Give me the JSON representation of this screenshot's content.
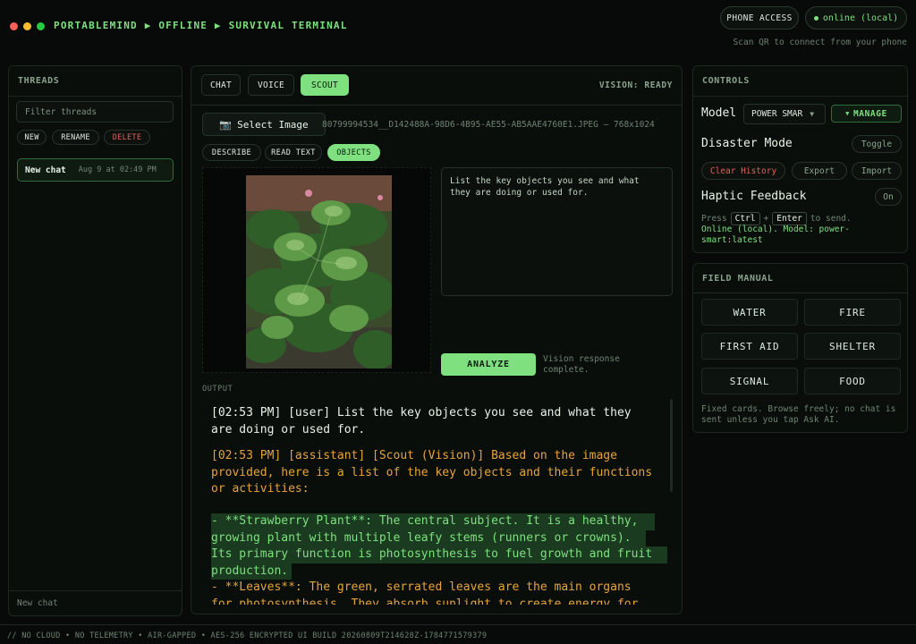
{
  "app": {
    "title": "PORTABLEMIND ▶ OFFLINE ▶ SURVIVAL TERMINAL",
    "window_dots": [
      "#ff5f57",
      "#febc2e",
      "#28c840"
    ],
    "phone_access_label": "PHONE ACCESS",
    "online_label": "online (local)",
    "qr_hint": "Scan QR to connect from your phone",
    "accent": "#7ee07f"
  },
  "threads": {
    "heading": "THREADS",
    "filter_placeholder": "Filter threads",
    "buttons": {
      "new": "NEW",
      "rename": "RENAME",
      "delete": "DELETE"
    },
    "items": [
      {
        "title": "New chat",
        "date": "Aug 9 at 02:49 PM"
      }
    ],
    "footer": "New chat"
  },
  "main": {
    "tabs": [
      "CHAT",
      "VOICE",
      "SCOUT"
    ],
    "active_tab": "SCOUT",
    "vision_status": "VISION: READY",
    "select_image_label": "Select Image",
    "camera_icon": "📷",
    "file_info": "80799994534__D142488A-98D6-4B95-AE55-AB5AAE4760E1.JPEG — 768x1024",
    "modes": [
      "DESCRIBE",
      "READ TEXT",
      "OBJECTS"
    ],
    "active_mode": "OBJECTS",
    "prompt_text": "List the key objects you see and what they are doing or used for.",
    "analyze_label": "ANALYZE",
    "analyze_status": "Vision response complete.",
    "output_label": "OUTPUT",
    "output_lines": [
      "[02:53 PM] [user] List the key objects you see and what they",
      "are doing or used for.",
      "[02:53 PM] [assistant] [Scout (Vision)] Based on the image",
      "provided, here is a list of the key objects and their functions",
      "or activities:",
      "- **Strawberry Plant**: The central subject. It is a healthy,",
      "growing plant with multiple leafy stems (runners or crowns).",
      "Its primary function is photosynthesis to fuel growth and fruit",
      "production.",
      "- **Leaves**: The green, serrated leaves are the main organs",
      "for photosynthesis. They absorb sunlight to create energy for"
    ]
  },
  "controls": {
    "heading": "CONTROLS",
    "model_label": "Model",
    "model_value": "POWER SMAR",
    "manage_label": "MANAGE",
    "disaster_label": "Disaster Mode",
    "toggle_label": "Toggle",
    "clear_history": "Clear History",
    "export": "Export",
    "import": "Import",
    "haptic_label": "Haptic Feedback",
    "haptic_value": "On",
    "press_prefix": "Press",
    "key_ctrl": "Ctrl",
    "key_plus": "+",
    "key_enter": "Enter",
    "press_suffix": "to send.",
    "status_line": "Online (local). Model: power-smart:latest"
  },
  "manual": {
    "heading": "FIELD MANUAL",
    "cards": [
      "WATER",
      "FIRE",
      "FIRST AID",
      "SHELTER",
      "SIGNAL",
      "FOOD"
    ],
    "note": "Fixed cards. Browse freely; no chat is sent unless you tap Ask AI."
  },
  "footer": {
    "text": "// NO CLOUD • NO TELEMETRY • AIR-GAPPED • AES-256 ENCRYPTED UI BUILD 20260809T214628Z-1784771579379"
  }
}
